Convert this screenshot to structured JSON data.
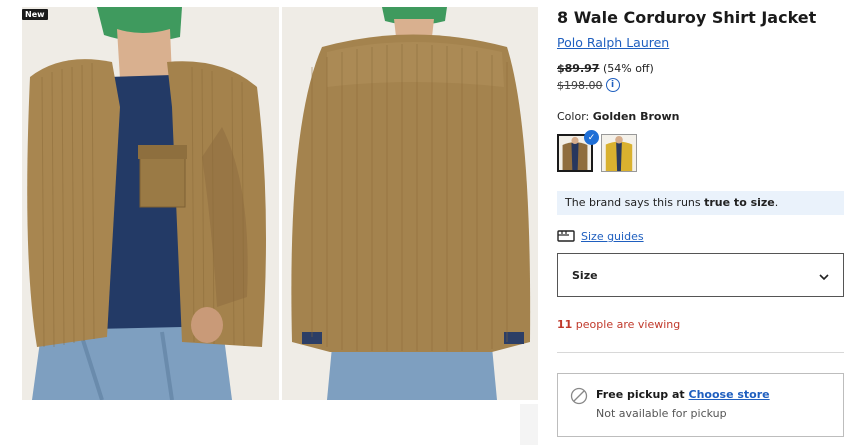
{
  "badge": "New",
  "product": {
    "title": "8 Wale Corduroy Shirt Jacket",
    "brand": "Polo Ralph Lauren",
    "sale_price": "$89.97",
    "discount": "(54% off)",
    "original_price": "$198.00",
    "info_glyph": "i"
  },
  "color": {
    "label": "Color: ",
    "selected": "Golden Brown"
  },
  "fit": {
    "prefix": "The brand says this runs ",
    "emphasis": "true to size",
    "suffix": "."
  },
  "size_guides": "Size guides",
  "size_select": {
    "label": "Size",
    "chevron": "⌄"
  },
  "viewing": {
    "count": "11",
    "text": " people are viewing"
  },
  "pickup": {
    "title": "Free pickup at ",
    "link": "Choose store",
    "status": "Not available for pickup"
  },
  "icons": {
    "info": "info-circle-icon",
    "check": "checkmark-icon",
    "size_guide": "ruler-icon",
    "chevron": "chevron-down-icon",
    "unavailable": "prohibited-icon"
  },
  "colors": {
    "link": "#1f5fbf",
    "fit_bg": "#eaf2fb",
    "viewing": "#c0392b",
    "check": "#1f6fd6"
  }
}
